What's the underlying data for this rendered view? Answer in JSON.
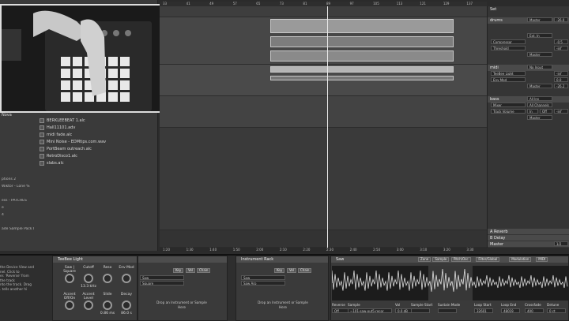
{
  "video": {
    "title": "Nova"
  },
  "browser": {
    "files": [
      "BERKLEEBEAT 1.alc",
      "Hall11101.adv",
      "midi fade.alc",
      "Mini Noise - EDMtips.com.wav",
      "PortBeam outreach.alc",
      "RetroDisco1.alc",
      "slabs.alc"
    ],
    "side_labels": [
      "ptions 2",
      "Wiktor - Lone %",
      "",
      "ess - PATCHES",
      "e",
      "4",
      "",
      "ade Sample Pack I"
    ]
  },
  "ruler": {
    "ticks": [
      "33",
      "41",
      "49",
      "57",
      "65",
      "73",
      "81",
      "89",
      "97",
      "105",
      "113",
      "121",
      "129",
      "137"
    ]
  },
  "bottom_ruler": {
    "ticks": [
      "1:20",
      "1:30",
      "1:40",
      "1:50",
      "2:00",
      "2:10",
      "2:20",
      "2:30",
      "2:40",
      "2:50",
      "3:00",
      "3:10",
      "3:20",
      "3:30"
    ]
  },
  "mixer": {
    "header": "Set",
    "track1": {
      "name": "drums",
      "io": "Master",
      "val": "-26.0"
    },
    "comp": {
      "name": "Compressor",
      "row2": "Threshold",
      "in": "Ext. In",
      "level": "-0.5",
      "level2": "-inf",
      "out": "Master"
    },
    "track2": {
      "name": "midi",
      "input": "No Input",
      "sub": "TeeBee Light",
      "sub2": "Env Mod",
      "v1": "-inf",
      "v2": "0.0",
      "v3": "-26.2",
      "out": "Master"
    },
    "track3": {
      "name": "bass",
      "input": "All Ins",
      "sub": "Mixer",
      "sub2": "Track Volume",
      "ch": "All Channels",
      "in": "In",
      "off": "Off",
      "v1": "-inf",
      "out": "Master"
    },
    "returns": [
      {
        "name": "A Reverb"
      },
      {
        "name": "B Delay"
      },
      {
        "name": "Master",
        "val": "1/2"
      }
    ]
  },
  "devices": {
    "info": "the Device View and\nnel. Click to\ner. 'Reverse' from\nthe track\nnto the track. Drag\n. tells another hi",
    "teebee": {
      "title": "TeeBee Light",
      "knobs": [
        "Saw | Square",
        "Cutoff",
        "Reso",
        "Env Mod",
        "Accent Off/On",
        "Accent Level",
        "Slide",
        "Decay"
      ],
      "vals": [
        "",
        "13.3 kHz",
        "",
        "",
        "",
        "",
        "0.86 ms",
        "86.0 s"
      ]
    },
    "rack1": {
      "title": "",
      "tabs": [
        "Key",
        "Vel",
        "Chain"
      ],
      "rows": [
        "Saw",
        "Square"
      ],
      "drop": "Drop an Instrument or Sample Here"
    },
    "rack2": {
      "title": "Instrument Rack",
      "tabs": [
        "Key",
        "Vel",
        "Chain"
      ],
      "rows": [
        "Saw",
        "Saw Arp"
      ],
      "drop": "Drop an Instrument or Sample Here"
    },
    "sampler": {
      "title": "Saw",
      "tabs": [
        "Zone",
        "Sample",
        "Pitch/Osc",
        "Filter/Global",
        "Modulation",
        "MIDI"
      ],
      "params": [
        "Reverse",
        "Sample",
        "Vol",
        "Sample Start",
        "Sustain Mode",
        "Loop Start",
        "Loop End",
        "Crossfade",
        "Detune"
      ],
      "values": [
        "Off",
        "~101-saw-out5-recor",
        "0.0 dB",
        "",
        "",
        "32601",
        "48019",
        "400",
        "0 ct"
      ]
    }
  }
}
